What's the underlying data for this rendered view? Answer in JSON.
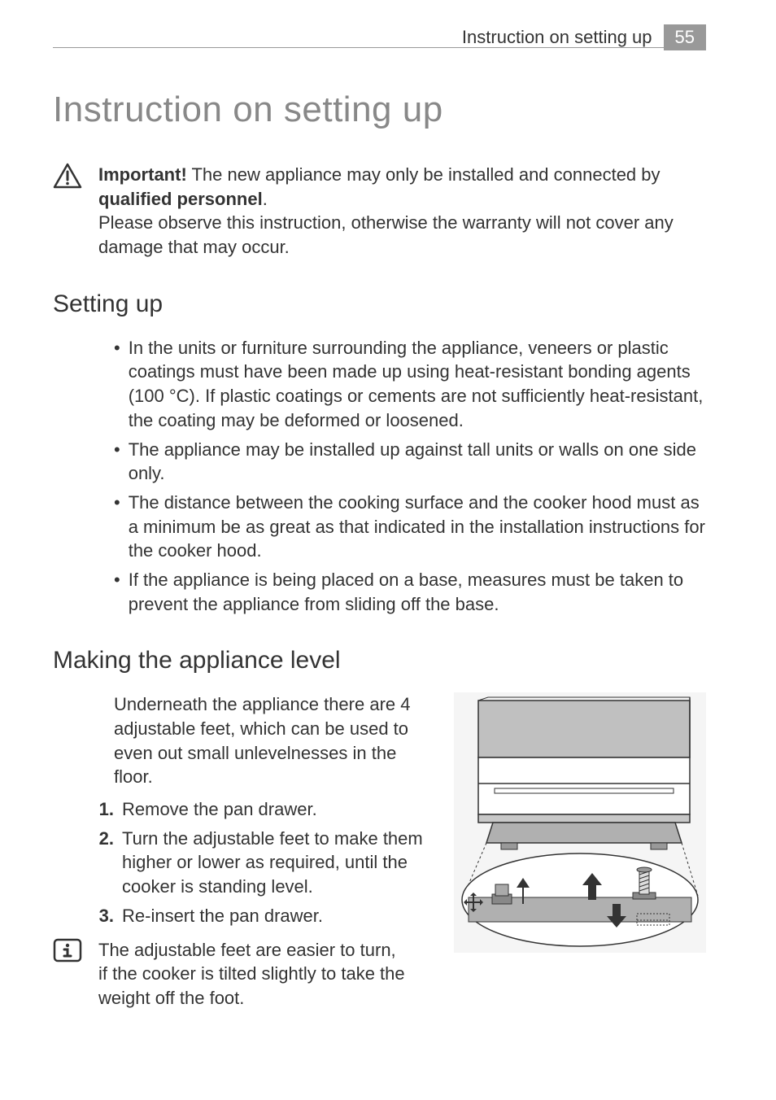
{
  "header": {
    "section_title": "Instruction on setting up",
    "page_number": "55"
  },
  "title": "Instruction on setting up",
  "warning": {
    "important_label": "Important!",
    "text1": " The new appliance may only be installed and connected by ",
    "qualified": "qualified personnel",
    "period": ".",
    "text2": "Please observe this instruction, otherwise the warranty will not cover any damage that may occur."
  },
  "section1": {
    "heading": "Setting up",
    "bullets": [
      "In the units or furniture surrounding the appliance, veneers or plastic coatings must have been made up using heat-resistant bonding agents (100 °C). If plastic coatings or cements are not sufficiently heat-resistant, the coating may be deformed or loosened.",
      "The appliance may be installed up against tall units or walls on one side only.",
      "The distance between the cooking surface and the cooker hood must as a minimum be as great as that indicated in the installation instructions for the cooker hood.",
      "If the appliance is being placed on a base, measures must be taken to prevent the appliance from sliding off the base."
    ]
  },
  "section2": {
    "heading": "Making the appliance level",
    "intro": "Underneath the appliance there are 4 adjustable feet, which can be used to even out small unlevelnesses in the floor.",
    "steps": [
      "Remove the pan drawer.",
      "Turn the adjustable feet to make them higher or lower as required, until the cooker is standing level.",
      "Re-insert the pan drawer."
    ],
    "info": "The adjustable feet are easier to turn, if the cooker is tilted slightly to take the weight off the foot."
  }
}
